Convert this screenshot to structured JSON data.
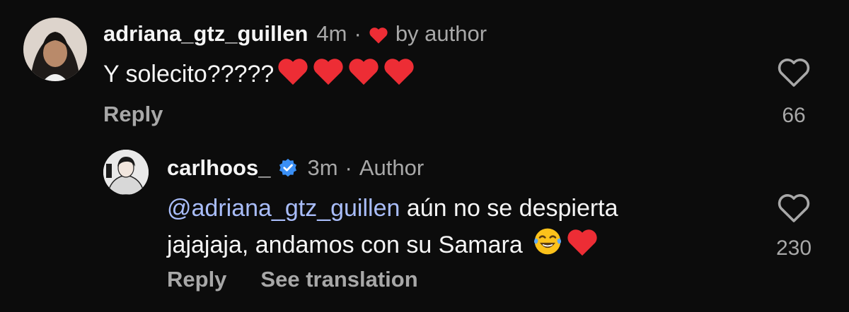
{
  "comments": [
    {
      "username": "adriana_gtz_guillen",
      "time": "4m",
      "separator": "·",
      "liked_by_author_label": "by author",
      "text": "Y solecito?????",
      "trailing_emojis": [
        "red-heart-emoji",
        "red-heart-emoji",
        "red-heart-emoji",
        "red-heart-emoji"
      ],
      "reply_label": "Reply",
      "like_count": "66",
      "like_icon": "heart-outline-icon"
    },
    {
      "username": "carlhoos_",
      "verified": true,
      "time": "3m",
      "separator": "·",
      "author_tag": "Author",
      "mention": "@adriana_gtz_guillen",
      "text_line1": " aún no se despierta",
      "text_line2": "jajajaja, andamos con su Samara ",
      "trailing_emojis": [
        "tears-of-joy-emoji",
        "red-heart-emoji"
      ],
      "reply_label": "Reply",
      "see_translation_label": "See translation",
      "like_count": "230",
      "like_icon": "heart-outline-icon"
    }
  ],
  "colors": {
    "background": "#0c0c0c",
    "primary_text": "#f5f5f5",
    "secondary_text": "#a8a8a8",
    "mention": "#a9bdfa",
    "heart_red": "#ed2d35",
    "verified_blue": "#3a8ff5"
  }
}
